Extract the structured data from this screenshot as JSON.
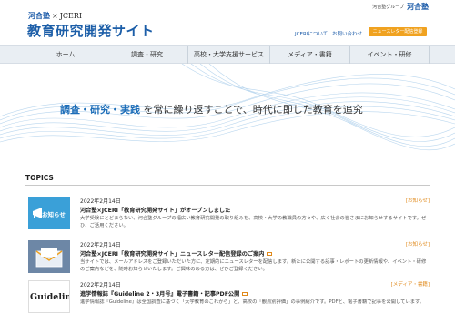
{
  "header": {
    "brand_kawaijuku": "河合塾",
    "brand_separator": "×",
    "brand_jceri": "JCERI",
    "site_title": "教育研究開発サイト",
    "group_label": "河合塾グループ",
    "group_logo": "河合塾",
    "about_link": "JCERIについて",
    "contact_link": "お問い合わせ",
    "newsletter_button": "ニュースレター配信登録"
  },
  "nav": {
    "items": [
      {
        "label": "ホーム"
      },
      {
        "label": "調査・研究"
      },
      {
        "label": "高校・大学支援サービス"
      },
      {
        "label": "メディア・書籍"
      },
      {
        "label": "イベント・研修"
      }
    ]
  },
  "hero": {
    "emphasis": "調査・研究・実践",
    "rest": "を常に繰り返すことで、時代に即した教育を追究"
  },
  "topics": {
    "title": "TOPICS",
    "items": [
      {
        "date": "2022年2月14日",
        "category": "[お知らせ]",
        "title": "河合塾×JCERI「教育研究開発サイト」がオープンしました",
        "description": "大学受験にとどまらない、河合塾グループの幅広い教育研究開発の取り組みを、高校・大学の教職員の方々や、広く社会の皆さまにお知らせするサイトです。ぜひ、ご活用ください。",
        "thumb_label": "お知らせ",
        "thumb_icon": "megaphone-icon",
        "has_ext_icon": false
      },
      {
        "date": "2022年2月14日",
        "category": "[お知らせ]",
        "title": "河合塾×JCERI「教育研究開発サイト」ニュースレター配信登録のご案内",
        "description": "当サイトでは、メールアドレスをご登録いただいた方に、定期的にニュースレターを配信します。新たに公開する記事・レポートの更新情報や、イベント・研修のご案内などを、随時お知らせいたします。ご興味のある方は、ぜひご登録ください。",
        "thumb_label": "",
        "thumb_icon": "envelope-icon",
        "has_ext_icon": true
      },
      {
        "date": "2022年2月14日",
        "category": "[メディア・書籍]",
        "title": "進学情報誌『Guideline 2・3月号』電子書籍・記事PDF公開",
        "description": "進学情報誌『Guideline』は全国調査に基づく「大学教育のこれから」と、高校の「観点別評価」の事例紹介です。PDFと、電子書籍で記事を公開しています。",
        "thumb_label": "Guideline",
        "thumb_icon": "guideline-magazine-icon",
        "has_ext_icon": true
      }
    ]
  },
  "colors": {
    "brand_blue": "#1c5ea8",
    "accent_orange": "#f0a220",
    "nav_bg": "#e9eef3",
    "hero_line": "#b9d6ee"
  }
}
